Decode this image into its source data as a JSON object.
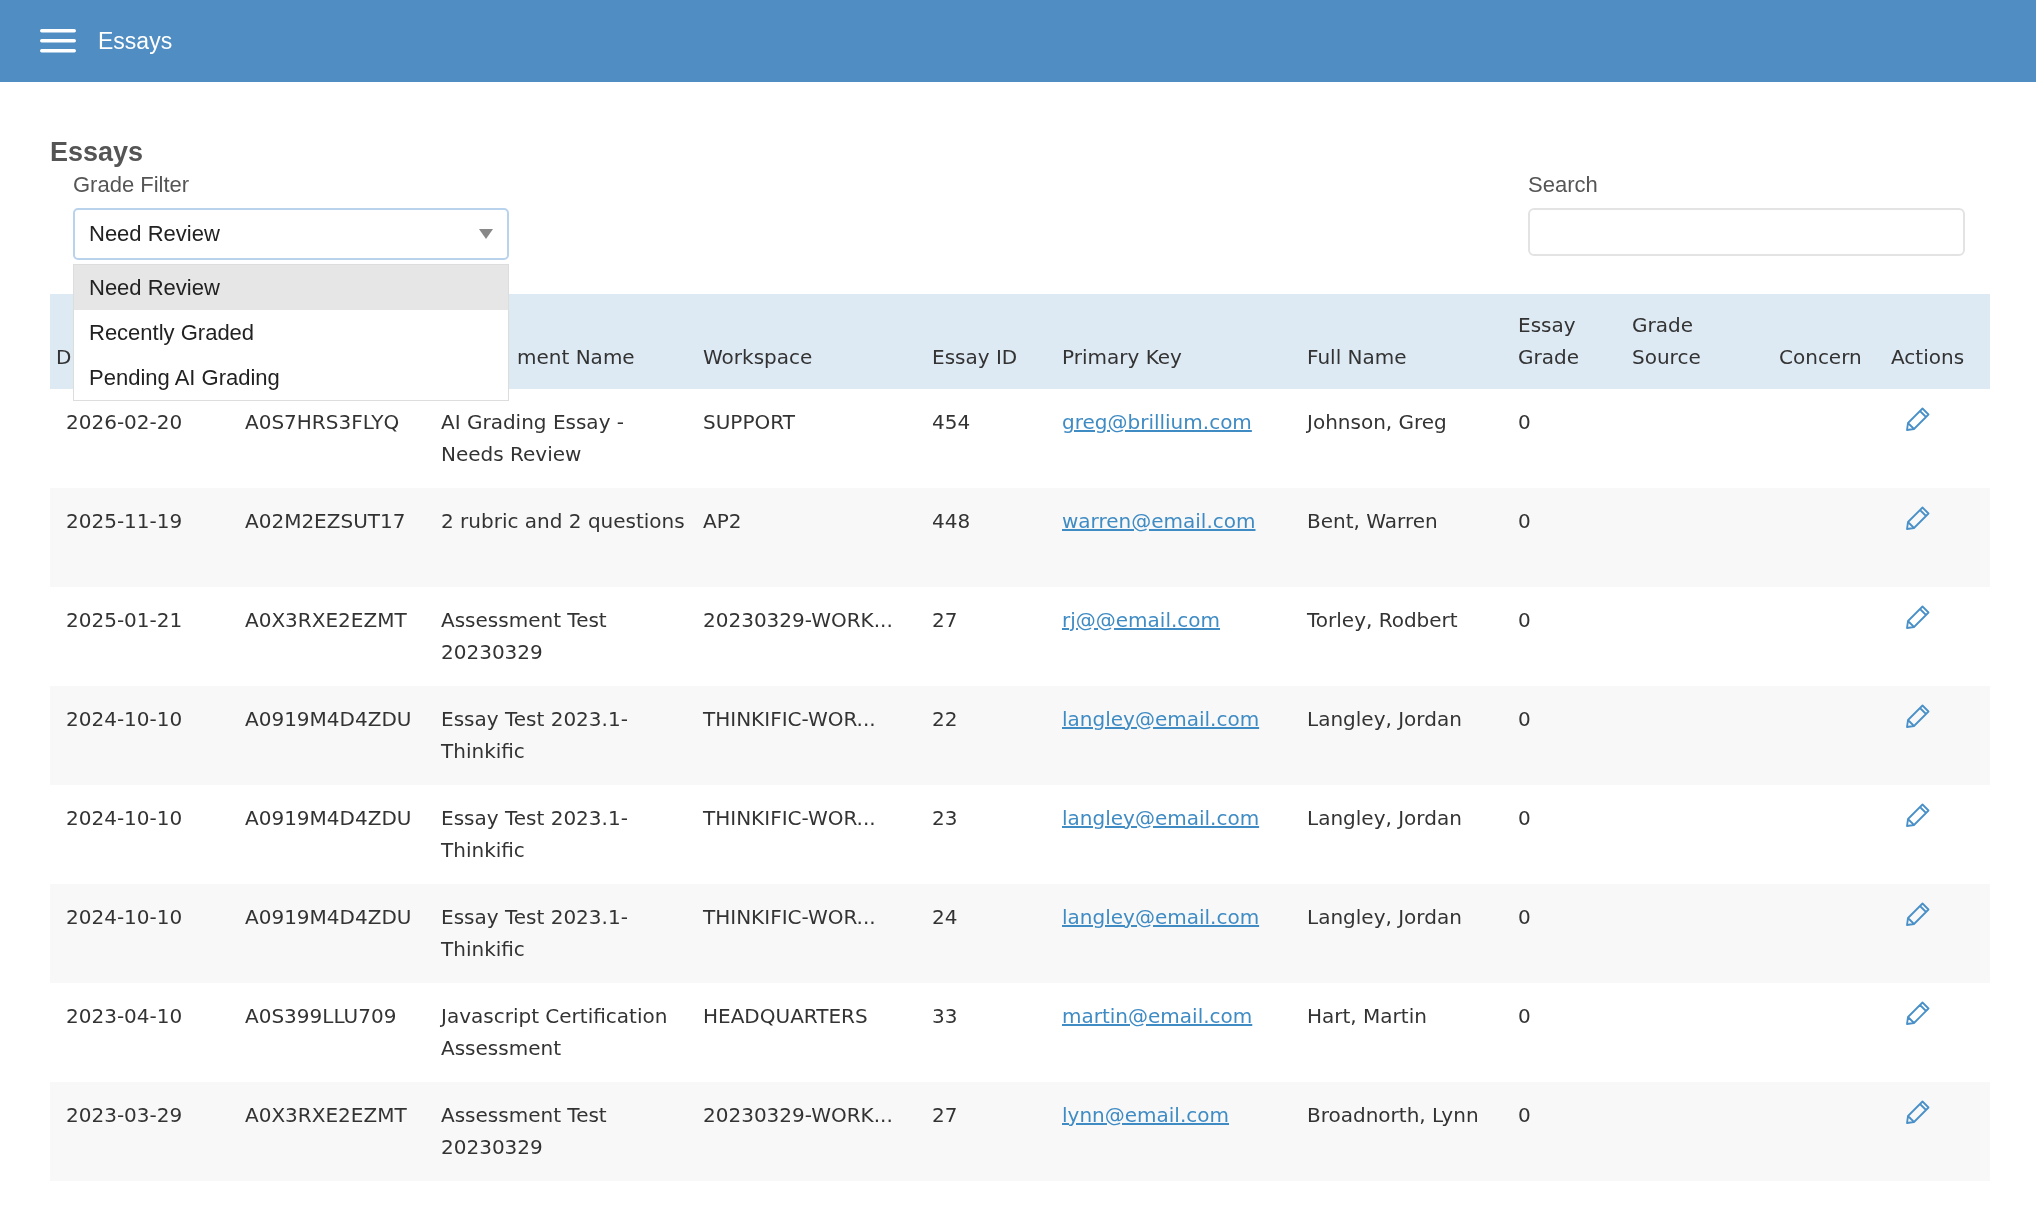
{
  "app_bar": {
    "title": "Essays"
  },
  "page_title": "Essays",
  "grade_filter": {
    "label": "Grade Filter",
    "value": "Need Review",
    "expanded": true,
    "options": [
      {
        "label": "Need Review",
        "selected": true
      },
      {
        "label": "Recently Graded",
        "selected": false
      },
      {
        "label": "Pending AI Grading",
        "selected": false
      }
    ]
  },
  "search": {
    "label": "Search"
  },
  "table": {
    "columns": [
      {
        "label": "D",
        "kind": "text"
      },
      {
        "kind": "text"
      },
      {
        "label": "ment Name",
        "kind": "text"
      },
      {
        "label": "Workspace",
        "kind": "text"
      },
      {
        "label": "Essay ID",
        "kind": "text"
      },
      {
        "label": "Primary Key",
        "kind": "link"
      },
      {
        "label": "Full Name",
        "kind": "text"
      },
      {
        "label": "Essay Grade",
        "kind": "text"
      },
      {
        "label": "Grade Source",
        "kind": "text"
      },
      {
        "label": "Concern",
        "kind": "text"
      },
      {
        "label": "Actions",
        "kind": "edit"
      }
    ],
    "rows": [
      {
        "cells": [
          "2026-02-20",
          "A0S7HRS3FLYQ",
          "AI Grading Essay - Needs Review",
          "SUPPORT",
          "454",
          "greg@brillium.com",
          "Johnson, Greg",
          "0"
        ]
      },
      {
        "cells": [
          "2025-11-19",
          "A02M2EZSUT17",
          "2 rubric and 2 questions",
          "AP2",
          "448",
          "warren@email.com",
          "Bent, Warren",
          "0"
        ]
      },
      {
        "cells": [
          "2025-01-21",
          "A0X3RXE2EZMT",
          "Assessment Test 20230329",
          "20230329-WORK...",
          "27",
          "rj@@email.com",
          "Torley, Rodbert",
          "0"
        ]
      },
      {
        "cells": [
          "2024-10-10",
          "A0919M4D4ZDU",
          "Essay Test 2023.1-Thinkific",
          "THINKIFIC-WOR...",
          "22",
          "langley@email.com",
          "Langley, Jordan",
          "0"
        ]
      },
      {
        "cells": [
          "2024-10-10",
          "A0919M4D4ZDU",
          "Essay Test 2023.1-Thinkific",
          "THINKIFIC-WOR...",
          "23",
          "langley@email.com",
          "Langley, Jordan",
          "0"
        ]
      },
      {
        "cells": [
          "2024-10-10",
          "A0919M4D4ZDU",
          "Essay Test 2023.1-Thinkific",
          "THINKIFIC-WOR...",
          "24",
          "langley@email.com",
          "Langley, Jordan",
          "0"
        ]
      },
      {
        "cells": [
          "2023-04-10",
          "A0S399LLU709",
          "Javascript Certification Assessment",
          "HEADQUARTERS",
          "33",
          "martin@email.com",
          "Hart, Martin",
          "0"
        ]
      },
      {
        "cells": [
          "2023-03-29",
          "A0X3RXE2EZMT",
          "Assessment Test 20230329",
          "20230329-WORK...",
          "27",
          "lynn@email.com",
          "Broadnorth, Lynn",
          "0"
        ]
      }
    ]
  }
}
